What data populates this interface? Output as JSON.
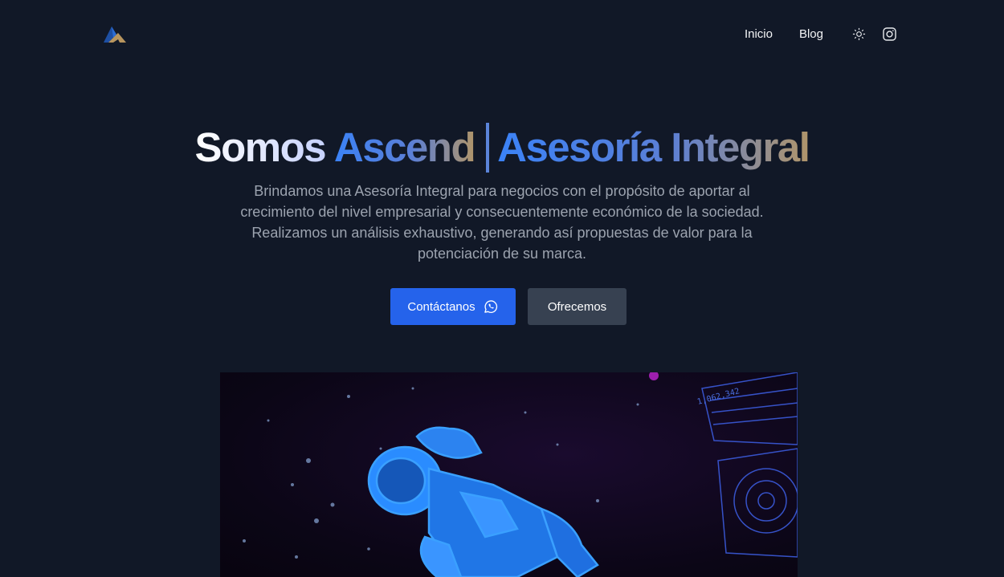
{
  "header": {
    "logo_name": "ascend-logo",
    "nav": {
      "inicio": "Inicio",
      "blog": "Blog"
    },
    "icons": [
      "sun-icon",
      "instagram-icon"
    ]
  },
  "hero": {
    "title_part1": "Somos",
    "title_part2": "Ascend",
    "title_part3": "Asesoría Integral",
    "description": "Brindamos una Asesoría Integral para negocios con el propósito de aportar al crecimiento del nivel empresarial y consecuentemente económico de la sociedad. Realizamos un análisis exhaustivo, generando así propuestas de valor para la potenciación de su marca.",
    "primary_button": "Contáctanos",
    "secondary_button": "Ofrecemos"
  },
  "image": {
    "overlay_text": "1,062,342"
  },
  "colors": {
    "background": "#111827",
    "primary": "#2563eb",
    "secondary": "#374151",
    "accent_gold": "#b0956a"
  }
}
